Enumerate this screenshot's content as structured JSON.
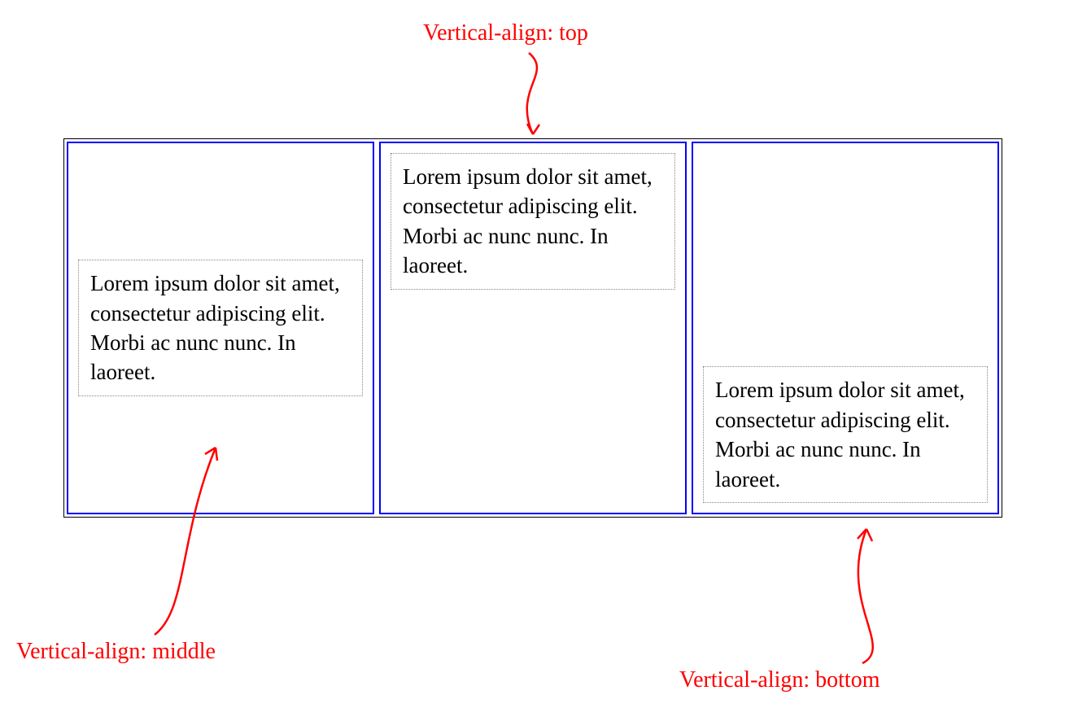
{
  "annotations": {
    "top": "Vertical-align: top",
    "middle": "Vertical-align: middle",
    "bottom": "Vertical-align: bottom"
  },
  "cells": {
    "middle": "Lorem ipsum dolor sit amet, consectetur adipiscing elit. Morbi ac nunc nunc. In laoreet.",
    "top": "Lorem ipsum dolor sit amet, consectetur adipiscing elit. Morbi ac nunc nunc. In laoreet.",
    "bottom": "Lorem ipsum dolor sit amet, consectetur adipiscing elit. Morbi ac nunc nunc. In laoreet."
  },
  "colors": {
    "cell_border": "#0000ff",
    "annotation": "#ff0000",
    "content_border": "#888888",
    "table_border": "#000000"
  }
}
